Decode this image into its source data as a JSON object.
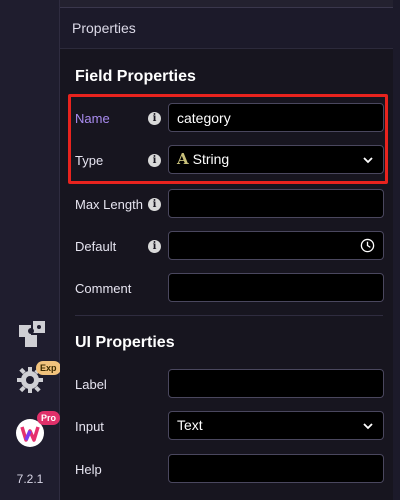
{
  "panel": {
    "header": "Properties"
  },
  "field_properties": {
    "title": "Field Properties",
    "name": {
      "label": "Name",
      "value": "category"
    },
    "type": {
      "label": "Type",
      "value": "String",
      "type_glyph": "A"
    },
    "max_length": {
      "label": "Max Length",
      "value": ""
    },
    "default": {
      "label": "Default",
      "value": ""
    },
    "comment": {
      "label": "Comment",
      "value": ""
    }
  },
  "ui_properties": {
    "title": "UI Properties",
    "label": {
      "label": "Label",
      "value": ""
    },
    "input": {
      "label": "Input",
      "value": "Text"
    },
    "help": {
      "label": "Help",
      "value": ""
    }
  },
  "rail": {
    "items": [
      {
        "icon": "puzzle-icon"
      },
      {
        "icon": "gear-icon",
        "badge": "Exp"
      },
      {
        "icon": "app-logo-icon",
        "badge": "Pro"
      }
    ],
    "version": "7.2.1"
  },
  "colors": {
    "accent_label": "#a98cf0",
    "highlight_border": "#e8231e",
    "badge_exp": "#f1c27d",
    "badge_pro": "#e0306a"
  }
}
